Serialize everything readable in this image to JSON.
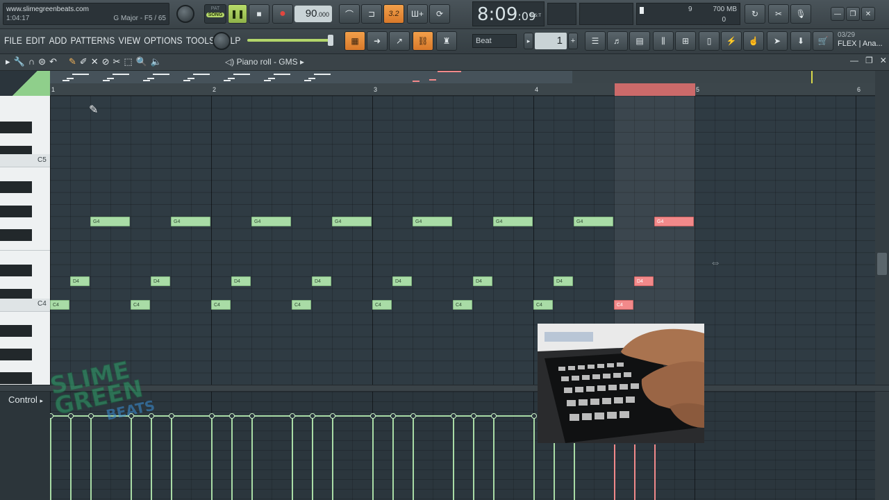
{
  "hint": {
    "website": "www.slimegreenbeats.com",
    "time": "1:04:17",
    "scale": "G Major - F5 / 65"
  },
  "transport": {
    "pat_label": "PAT",
    "song_label": "SONG",
    "tempo": "90",
    "tempo_frac": ".000",
    "clock_main": "8:09",
    "clock_sec": "09",
    "clock_unit": "B:S:T",
    "snap_label": "3.2"
  },
  "cpu": {
    "voices": "9",
    "memory": "700 MB",
    "cpu_val": "0"
  },
  "menu": [
    "FILE",
    "EDIT",
    "ADD",
    "PATTERNS",
    "VIEW",
    "OPTIONS",
    "TOOLS",
    "HELP"
  ],
  "snap": {
    "beat_label": "Beat",
    "pattern_number": "1"
  },
  "flex": {
    "date": "03/29",
    "label": "FLEX | Ana..."
  },
  "pianoroll": {
    "title": "Piano roll - GMS"
  },
  "bars": [
    "1",
    "2",
    "3",
    "4",
    "5",
    "6"
  ],
  "keys": {
    "c5": "C5",
    "c4": "C4"
  },
  "notes": [
    {
      "label": "G4",
      "x": 1,
      "len": 1,
      "pitch": "G4"
    },
    {
      "label": "G4",
      "x": 3,
      "len": 1,
      "pitch": "G4"
    },
    {
      "label": "G4",
      "x": 5,
      "len": 1,
      "pitch": "G4"
    },
    {
      "label": "G4",
      "x": 7,
      "len": 1,
      "pitch": "G4"
    },
    {
      "label": "G4",
      "x": 9,
      "len": 1,
      "pitch": "G4"
    },
    {
      "label": "G4",
      "x": 11,
      "len": 1,
      "pitch": "G4"
    },
    {
      "label": "G4",
      "x": 13,
      "len": 1,
      "pitch": "G4"
    },
    {
      "label": "G4",
      "x": 15,
      "len": 1,
      "pitch": "G4",
      "selected": true
    },
    {
      "label": "D4",
      "x": 0.5,
      "len": 0.5,
      "pitch": "D4"
    },
    {
      "label": "D4",
      "x": 2.5,
      "len": 0.5,
      "pitch": "D4"
    },
    {
      "label": "D4",
      "x": 4.5,
      "len": 0.5,
      "pitch": "D4"
    },
    {
      "label": "D4",
      "x": 6.5,
      "len": 0.5,
      "pitch": "D4"
    },
    {
      "label": "D4",
      "x": 8.5,
      "len": 0.5,
      "pitch": "D4"
    },
    {
      "label": "D4",
      "x": 10.5,
      "len": 0.5,
      "pitch": "D4"
    },
    {
      "label": "D4",
      "x": 12.5,
      "len": 0.5,
      "pitch": "D4"
    },
    {
      "label": "D4",
      "x": 14.5,
      "len": 0.5,
      "pitch": "D4",
      "selected": true
    },
    {
      "label": "C4",
      "x": 0,
      "len": 0.5,
      "pitch": "C4"
    },
    {
      "label": "C4",
      "x": 2,
      "len": 0.5,
      "pitch": "C4"
    },
    {
      "label": "C4",
      "x": 4,
      "len": 0.5,
      "pitch": "C4"
    },
    {
      "label": "C4",
      "x": 6,
      "len": 0.5,
      "pitch": "C4"
    },
    {
      "label": "C4",
      "x": 8,
      "len": 0.5,
      "pitch": "C4"
    },
    {
      "label": "C4",
      "x": 10,
      "len": 0.5,
      "pitch": "C4"
    },
    {
      "label": "C4",
      "x": 12,
      "len": 0.5,
      "pitch": "C4"
    },
    {
      "label": "C4",
      "x": 14,
      "len": 0.5,
      "pitch": "C4",
      "selected": true
    }
  ],
  "control": {
    "label": "Control"
  },
  "watermark": {
    "line1": "SLIME",
    "line2": "GREEN",
    "line3": "BEATS"
  },
  "colors": {
    "note": "#a9dca6",
    "selected_note": "#f2898a",
    "accent": "#f3a04a",
    "grid": "#2f3b43"
  }
}
